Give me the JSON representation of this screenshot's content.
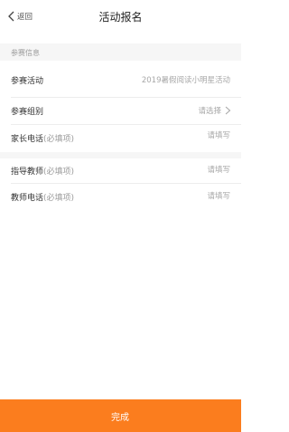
{
  "header": {
    "back_label": "返回",
    "title": "活动报名"
  },
  "section": {
    "title": "参赛信息"
  },
  "rows": [
    {
      "label": "参赛活动",
      "hint": "",
      "value": "2019暑假阅读小明星活动"
    },
    {
      "label": "参赛组别",
      "hint": "",
      "value": "请选择"
    },
    {
      "label": "家长电话",
      "hint": "(必填项)",
      "value": "请填写"
    },
    {
      "label": "指导教师",
      "hint": "(必填项)",
      "value": "请填写"
    },
    {
      "label": "教师电话",
      "hint": "(必填项)",
      "value": "请填写"
    }
  ],
  "footer": {
    "complete_label": "完成"
  },
  "colors": {
    "accent": "#fb7d1e",
    "placeholder": "#a8a8a8",
    "section_bg": "#f6f6f6"
  }
}
